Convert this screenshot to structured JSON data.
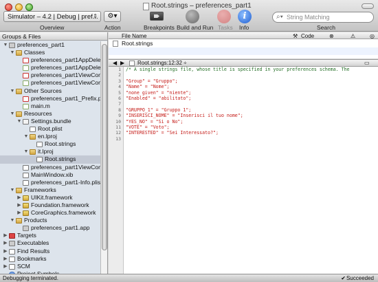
{
  "window": {
    "title": "Root.strings – preferences_part1"
  },
  "toolbar": {
    "scheme": "Simulator – 4.2 | Debug | pref...",
    "overview": "Overview",
    "action": "Action",
    "breakpoints": "Breakpoints",
    "build_run": "Build and Run",
    "tasks": "Tasks",
    "info": "Info",
    "search_placeholder": "String Matching",
    "search": "Search"
  },
  "sidebar": {
    "header": "Groups & Files",
    "items": [
      {
        "label": "preferences_part1",
        "indent": 0,
        "disc": "▼",
        "icon": "app"
      },
      {
        "label": "Classes",
        "indent": 1,
        "disc": "▼",
        "icon": "folder"
      },
      {
        "label": "preferences_part1AppDelegate.h",
        "indent": 2,
        "disc": "",
        "icon": "file-h"
      },
      {
        "label": "preferences_part1AppDelegate.m",
        "indent": 2,
        "disc": "",
        "icon": "file-m"
      },
      {
        "label": "preferences_part1ViewController.h",
        "indent": 2,
        "disc": "",
        "icon": "file-h"
      },
      {
        "label": "preferences_part1ViewController.m",
        "indent": 2,
        "disc": "",
        "icon": "file-m"
      },
      {
        "label": "Other Sources",
        "indent": 1,
        "disc": "▼",
        "icon": "folder"
      },
      {
        "label": "preferences_part1_Prefix.pch",
        "indent": 2,
        "disc": "",
        "icon": "file-h"
      },
      {
        "label": "main.m",
        "indent": 2,
        "disc": "",
        "icon": "file-m"
      },
      {
        "label": "Resources",
        "indent": 1,
        "disc": "▼",
        "icon": "folder"
      },
      {
        "label": "Settings.bundle",
        "indent": 2,
        "disc": "▼",
        "icon": "bundle"
      },
      {
        "label": "Root.plist",
        "indent": 3,
        "disc": "",
        "icon": "file-x"
      },
      {
        "label": "en.lproj",
        "indent": 3,
        "disc": "▼",
        "icon": "folder"
      },
      {
        "label": "Root.strings",
        "indent": 4,
        "disc": "",
        "icon": "file-x"
      },
      {
        "label": "it.lproj",
        "indent": 3,
        "disc": "▼",
        "icon": "folder"
      },
      {
        "label": "Root.strings",
        "indent": 4,
        "disc": "",
        "icon": "file-x",
        "selected": true
      },
      {
        "label": "preferences_part1ViewController.xib",
        "indent": 2,
        "disc": "",
        "icon": "file-x"
      },
      {
        "label": "MainWindow.xib",
        "indent": 2,
        "disc": "",
        "icon": "file-x"
      },
      {
        "label": "preferences_part1-Info.plist",
        "indent": 2,
        "disc": "",
        "icon": "file-x"
      },
      {
        "label": "Frameworks",
        "indent": 1,
        "disc": "▼",
        "icon": "folder"
      },
      {
        "label": "UIKit.framework",
        "indent": 2,
        "disc": "▶",
        "icon": "fw"
      },
      {
        "label": "Foundation.framework",
        "indent": 2,
        "disc": "▶",
        "icon": "fw"
      },
      {
        "label": "CoreGraphics.framework",
        "indent": 2,
        "disc": "▶",
        "icon": "fw"
      },
      {
        "label": "Products",
        "indent": 1,
        "disc": "▼",
        "icon": "folder"
      },
      {
        "label": "preferences_part1.app",
        "indent": 2,
        "disc": "",
        "icon": "app"
      },
      {
        "label": "Targets",
        "indent": 0,
        "disc": "▶",
        "icon": "red"
      },
      {
        "label": "Executables",
        "indent": 0,
        "disc": "▶",
        "icon": "app"
      },
      {
        "label": "Find Results",
        "indent": 0,
        "disc": "▶",
        "icon": "file-x"
      },
      {
        "label": "Bookmarks",
        "indent": 0,
        "disc": "▶",
        "icon": "file-x"
      },
      {
        "label": "SCM",
        "indent": 0,
        "disc": "▶",
        "icon": "file-x"
      },
      {
        "label": "Project Symbols",
        "indent": 0,
        "disc": "",
        "icon": "smart"
      },
      {
        "label": "Implementation Files",
        "indent": 0,
        "disc": "▶",
        "icon": "smart"
      },
      {
        "label": "Interface Builder Files",
        "indent": 0,
        "disc": "▶",
        "icon": "smart"
      }
    ]
  },
  "file_list": {
    "col_file": "File Name",
    "col_code": "Code",
    "row": "Root.strings"
  },
  "editor": {
    "file_label": "Root.strings:12:32 ÷",
    "line_numbers": [
      "1",
      "2",
      "3",
      "4",
      "5",
      "6",
      "7",
      "8",
      "9",
      "10",
      "11",
      "12",
      "13"
    ],
    "lines": [
      {
        "text": "/* A single strings file, whose title is specified in your preferences schema. The",
        "kind": "cm"
      },
      {
        "text": "",
        "kind": "st"
      },
      {
        "text": "\"Group\" = \"Gruppo\";",
        "kind": "st"
      },
      {
        "text": "\"Name\" = \"Nome\";",
        "kind": "st"
      },
      {
        "text": "\"none given\" = \"niente\";",
        "kind": "st"
      },
      {
        "text": "\"Enabled\" = \"abilitato\";",
        "kind": "st"
      },
      {
        "text": "",
        "kind": "st"
      },
      {
        "text": "\"GRUPPO_1\" = \"Gruppo 1\";",
        "kind": "st"
      },
      {
        "text": "\"INSERISCI_NOME\" = \"Inserisci il tuo nome\";",
        "kind": "st"
      },
      {
        "text": "\"YES_NO\" = \"Si o No\";",
        "kind": "st"
      },
      {
        "text": "\"VOTE\" = \"Voto\";",
        "kind": "st"
      },
      {
        "text": "\"INTERESTED\" = \"Sei Interessato?\";",
        "kind": "st"
      },
      {
        "text": "",
        "kind": "st"
      }
    ]
  },
  "status": {
    "message": "Debugging terminated.",
    "result": "Succeeded"
  }
}
